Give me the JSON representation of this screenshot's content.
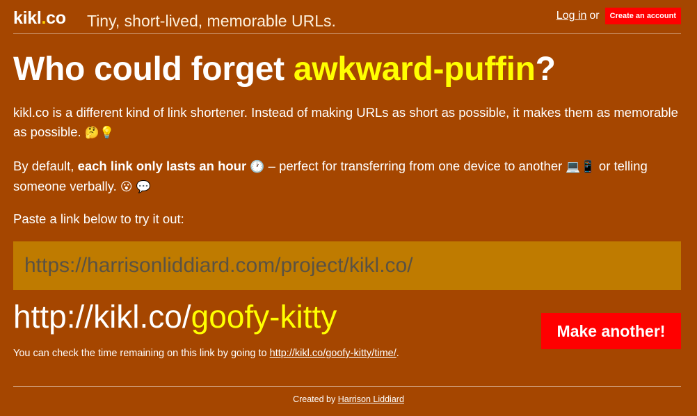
{
  "header": {
    "logo_main": "kikl",
    "logo_dot": ".",
    "logo_tld": "co",
    "tagline": "Tiny, short-lived, memorable URLs.",
    "login_label": "Log in",
    "or_text": "or",
    "create_account_label": "Create an account"
  },
  "headline": {
    "prefix": "Who could forget ",
    "highlight": "awkward-puffin",
    "suffix": "?"
  },
  "intro": {
    "text": "kikl.co is a different kind of link shortener. Instead of making URLs as short as possible, it makes them as memorable as possible.",
    "emoji_thinking": "🤔",
    "emoji_bulb": "💡"
  },
  "expiry": {
    "lead": "By default, ",
    "bold": "each link only lasts an hour",
    "emoji_clock": "🕐",
    "middle": " – perfect for transferring from one device to another ",
    "emoji_laptop": "💻",
    "emoji_phone": "📱",
    "tail": " or telling someone verbally. ",
    "emoji_surprised": "😮",
    "emoji_speech": "💬"
  },
  "prompt": "Paste a link below to try it out:",
  "url_input": {
    "value": "https://harrisonliddiard.com/project/kikl.co/"
  },
  "result": {
    "base": "http://kikl.co/",
    "slug": "goofy-kitty"
  },
  "make_another_label": "Make another!",
  "note": {
    "text": "You can check the time remaining on this link by going to ",
    "link": "http://kikl.co/goofy-kitty/time/",
    "end": "."
  },
  "footer": {
    "prefix": "Created by ",
    "author": "Harrison Liddiard"
  },
  "colors": {
    "background": "#a54600",
    "highlight": "#ffff00",
    "input_bg": "#bf7b00",
    "button_red": "#ff0000"
  }
}
